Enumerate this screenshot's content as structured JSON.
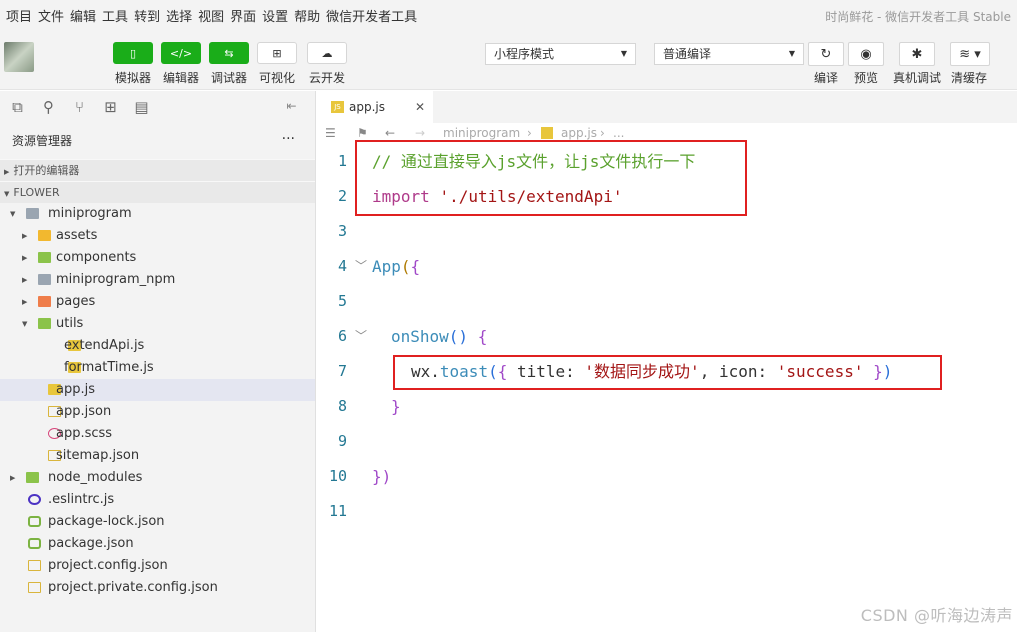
{
  "menubar": {
    "items": [
      "项目",
      "文件",
      "编辑",
      "工具",
      "转到",
      "选择",
      "视图",
      "界面",
      "设置",
      "帮助",
      "微信开发者工具"
    ],
    "window_title": "时尚鲜花 - 微信开发者工具 Stable"
  },
  "toolbar": {
    "buttons": [
      {
        "label": "模拟器",
        "icon": "phone-icon",
        "style": "green"
      },
      {
        "label": "编辑器",
        "icon": "code-icon",
        "style": "green"
      },
      {
        "label": "调试器",
        "icon": "debugger-icon",
        "style": "green"
      },
      {
        "label": "可视化",
        "icon": "layout-icon",
        "style": "white"
      },
      {
        "label": "云开发",
        "icon": "cloud-icon",
        "style": "white"
      }
    ],
    "mode_select": "小程序模式",
    "compile_select": "普通编译",
    "right_buttons": [
      {
        "label": "编译",
        "icon": "refresh-icon"
      },
      {
        "label": "预览",
        "icon": "eye-icon"
      },
      {
        "label": "真机调试",
        "icon": "bug-icon"
      },
      {
        "label": "清缓存",
        "icon": "layers-icon"
      }
    ]
  },
  "sidebar": {
    "panel_title": "资源管理器",
    "more": "···",
    "open_editors": "打开的编辑器",
    "project": "FLOWER",
    "tree": [
      {
        "label": "miniprogram",
        "kind": "folder-open",
        "depth": 1
      },
      {
        "label": "assets",
        "kind": "folder",
        "depth": 2
      },
      {
        "label": "components",
        "kind": "folder",
        "depth": 2
      },
      {
        "label": "miniprogram_npm",
        "kind": "folder",
        "depth": 2
      },
      {
        "label": "pages",
        "kind": "folder",
        "depth": 2
      },
      {
        "label": "utils",
        "kind": "folder-open",
        "depth": 2
      },
      {
        "label": "extendApi.js",
        "kind": "js",
        "depth": 3
      },
      {
        "label": "formatTime.js",
        "kind": "js",
        "depth": 3
      },
      {
        "label": "app.js",
        "kind": "js",
        "depth": 2,
        "active": true
      },
      {
        "label": "app.json",
        "kind": "json",
        "depth": 2
      },
      {
        "label": "app.scss",
        "kind": "scss",
        "depth": 2
      },
      {
        "label": "sitemap.json",
        "kind": "json",
        "depth": 2
      },
      {
        "label": "node_modules",
        "kind": "folder",
        "depth": 1
      },
      {
        "label": ".eslintrc.js",
        "kind": "eslint",
        "depth": 1
      },
      {
        "label": "package-lock.json",
        "kind": "npm",
        "depth": 1
      },
      {
        "label": "package.json",
        "kind": "npm",
        "depth": 1
      },
      {
        "label": "project.config.json",
        "kind": "json",
        "depth": 1
      },
      {
        "label": "project.private.config.json",
        "kind": "json",
        "depth": 1
      }
    ]
  },
  "editor": {
    "tab": {
      "name": "app.js",
      "close": "✕"
    },
    "breadcrumb": [
      "miniprogram",
      "app.js",
      "..."
    ],
    "lines": [
      {
        "n": "1",
        "comment": "// 通过直接导入js文件，让js文件执行一下"
      },
      {
        "n": "2",
        "kw": "import",
        "str": "'./utils/extendApi'"
      },
      {
        "n": "3"
      },
      {
        "n": "4",
        "fn": "App",
        "open": "({"
      },
      {
        "n": "5"
      },
      {
        "n": "6",
        "method": "onShow",
        "rest": "() {"
      },
      {
        "n": "7",
        "obj": "wx",
        "call": "toast",
        "k1": "title",
        "v1": "'数据同步成功'",
        "k2": "icon",
        "v2": "'success'"
      },
      {
        "n": "8",
        "close": "}"
      },
      {
        "n": "9"
      },
      {
        "n": "10",
        "close": "})"
      },
      {
        "n": "11"
      }
    ]
  },
  "watermark": "CSDN @听海边涛声"
}
